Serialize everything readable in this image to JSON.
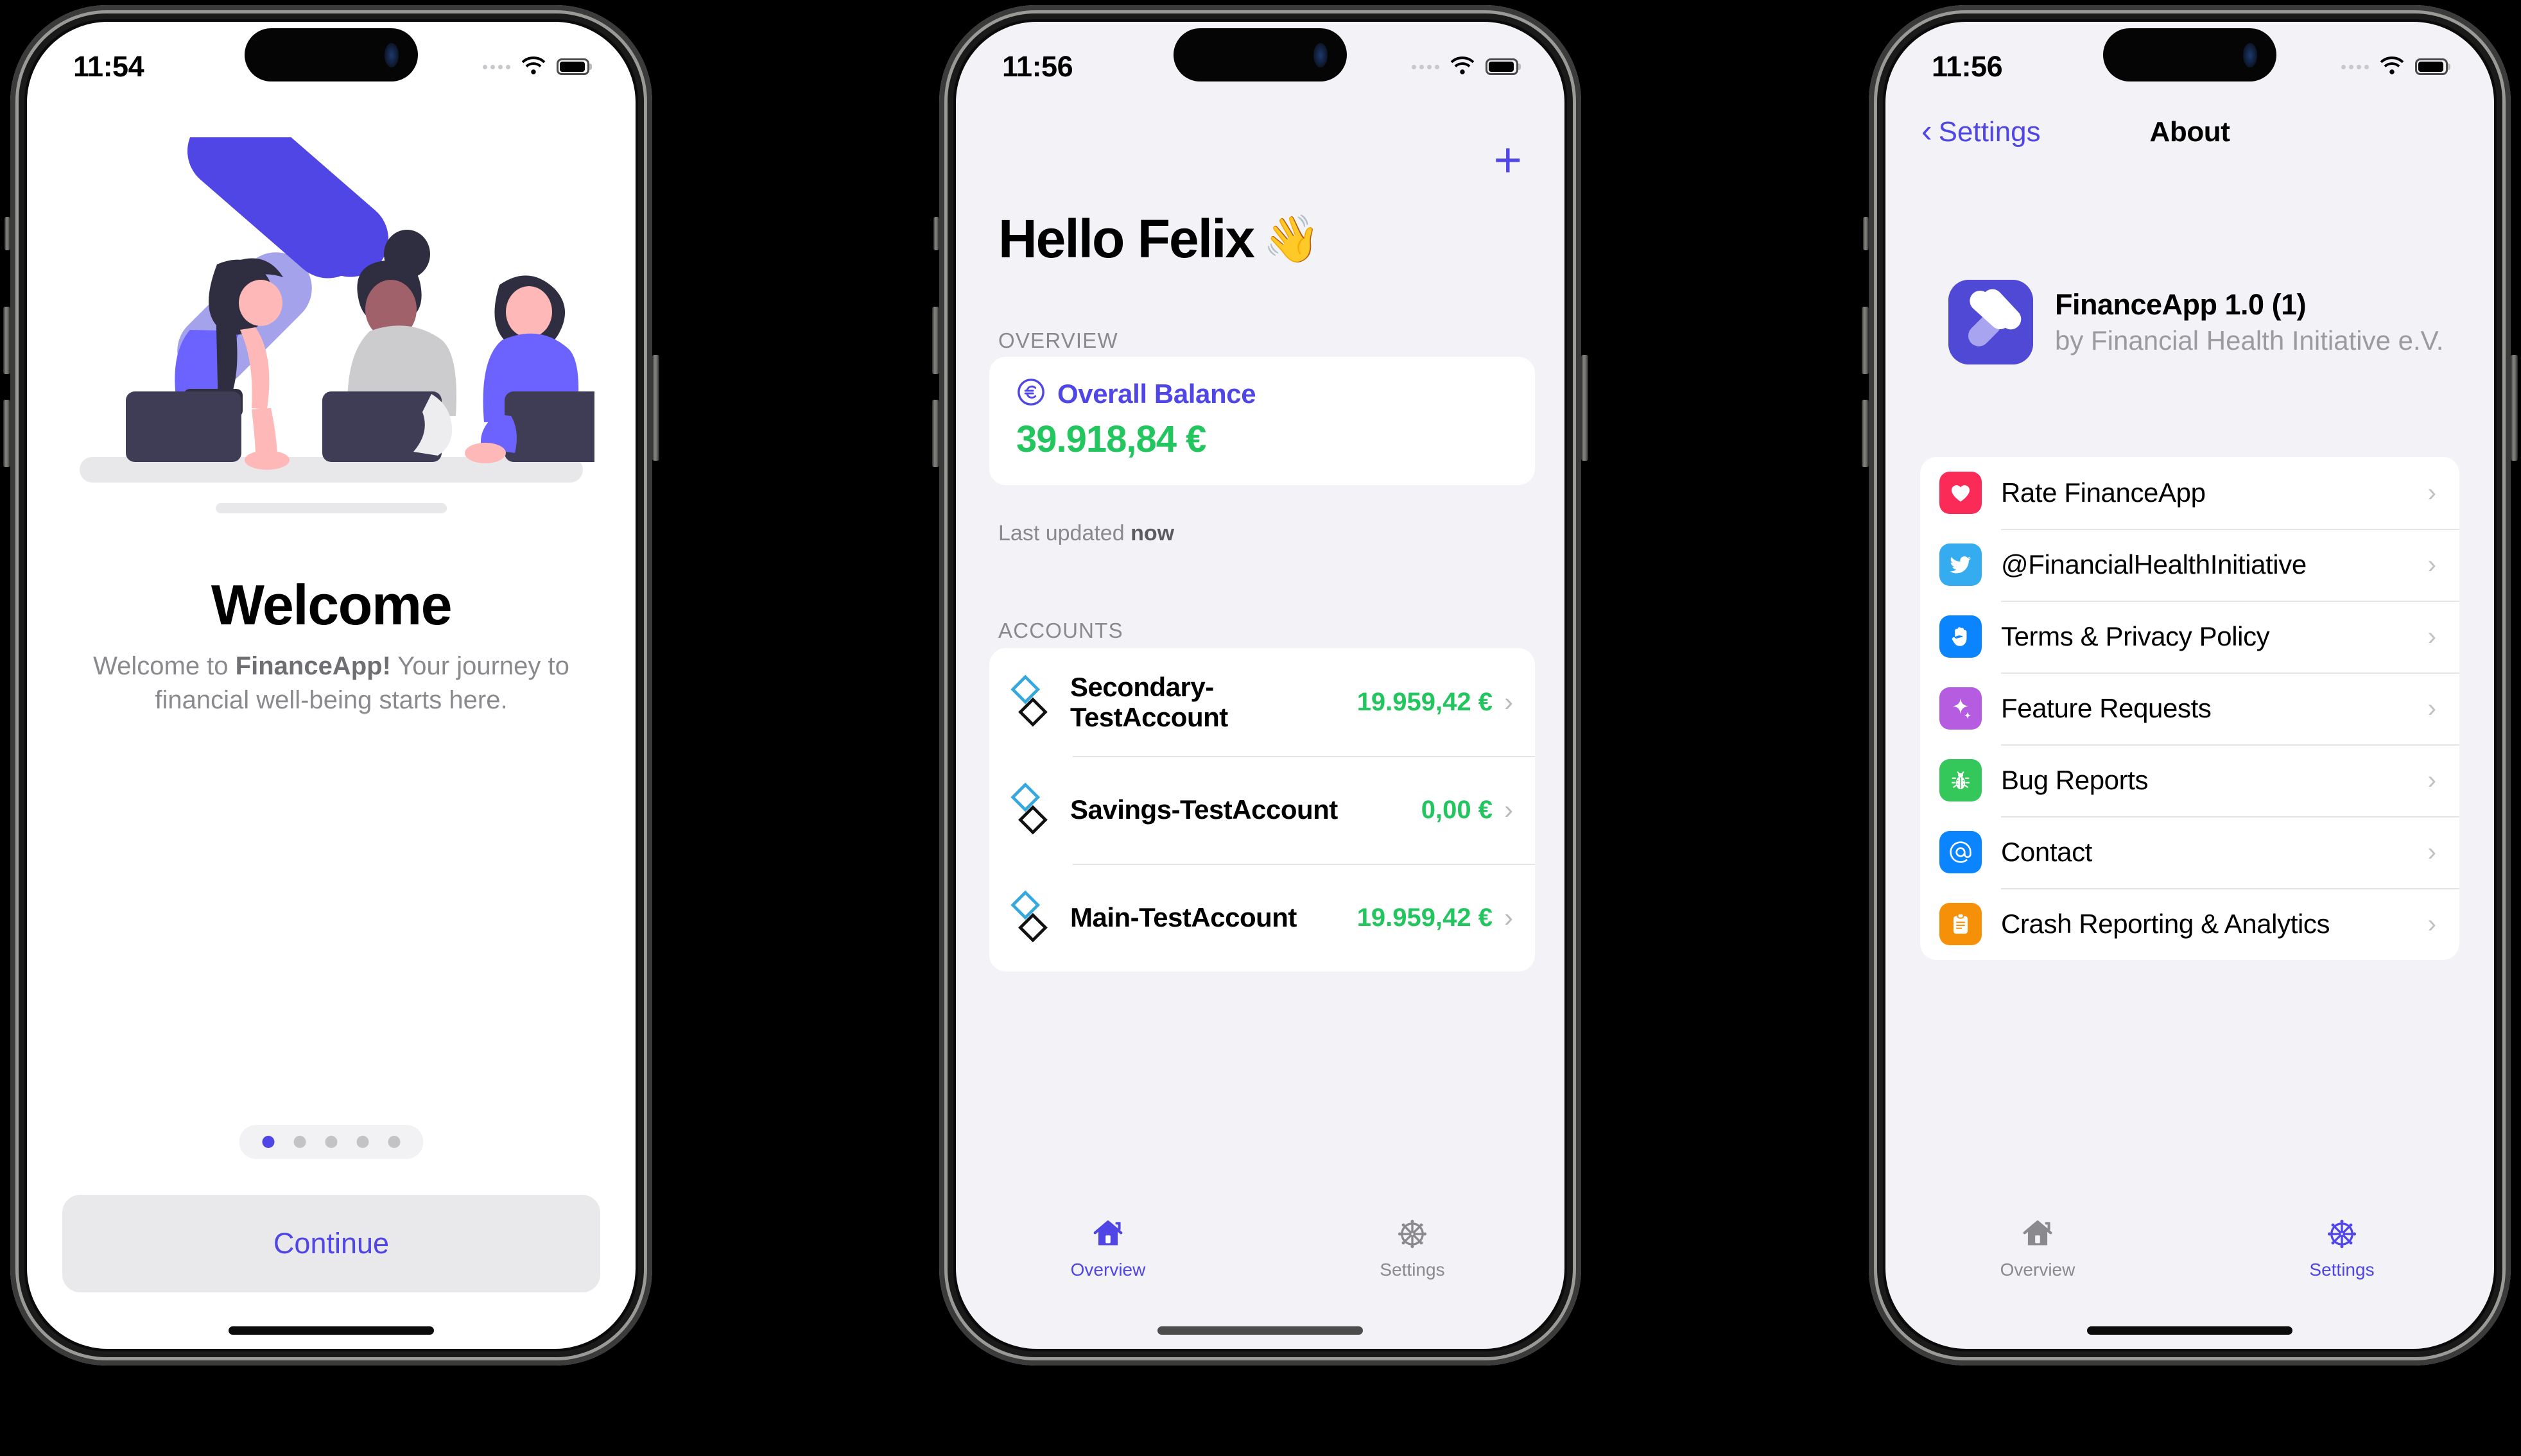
{
  "phones": [
    {
      "id": "welcome",
      "status": {
        "time": "11:54",
        "wifi_icon": "wifi-icon",
        "battery_icon": "battery-icon",
        "signal_icon": "cellular-dots-icon"
      },
      "welcome": {
        "title": "Welcome",
        "subtitle_pre": "Welcome to ",
        "subtitle_bold": "FinanceApp!",
        "subtitle_post": " Your journey to financial well-being starts here.",
        "page_indicator": {
          "total": 5,
          "active_index": 0
        },
        "continue_label": "Continue"
      }
    },
    {
      "id": "overview",
      "status": {
        "time": "11:56",
        "wifi_icon": "wifi-icon",
        "battery_icon": "battery-icon",
        "signal_icon": "cellular-dots-icon"
      },
      "overview": {
        "add_icon": "plus-icon",
        "greeting": "Hello Felix",
        "greeting_emoji": "👋",
        "section_overview": "OVERVIEW",
        "balance_icon": "euro-circle-icon",
        "balance_title": "Overall Balance",
        "balance_amount": "39.918,84 €",
        "last_updated_pre": "Last updated ",
        "last_updated_value": "now",
        "section_accounts": "ACCOUNTS",
        "accounts": [
          {
            "name": "Secondary-TestAccount",
            "amount": "19.959,42 €",
            "icon": "double-diamond-icon",
            "chevron": "chevron-right-icon"
          },
          {
            "name": "Savings-TestAccount",
            "amount": "0,00 €",
            "icon": "double-diamond-icon",
            "chevron": "chevron-right-icon"
          },
          {
            "name": "Main-TestAccount",
            "amount": "19.959,42 €",
            "icon": "double-diamond-icon",
            "chevron": "chevron-right-icon"
          }
        ]
      },
      "tabbar": {
        "tabs": [
          {
            "label": "Overview",
            "icon": "house-icon",
            "active": true
          },
          {
            "label": "Settings",
            "icon": "gear-icon",
            "active": false
          }
        ]
      }
    },
    {
      "id": "about",
      "status": {
        "time": "11:56",
        "wifi_icon": "wifi-icon",
        "battery_icon": "battery-icon",
        "signal_icon": "cellular-dots-icon"
      },
      "about": {
        "back_label": "Settings",
        "back_icon": "chevron-left-icon",
        "title": "About",
        "app_icon": "financeapp-logo-icon",
        "app_name": "FinanceApp 1.0 (1)",
        "app_publisher": "by Financial Health Initiative e.V.",
        "rows": [
          {
            "label": "Rate FinanceApp",
            "icon": "heart-icon",
            "color": "#fa2b56"
          },
          {
            "label": "@FinancialHealthInitiative",
            "icon": "twitter-icon",
            "color": "#35acef"
          },
          {
            "label": "Terms & Privacy Policy",
            "icon": "hand-raised-icon",
            "color": "#0b84ff"
          },
          {
            "label": "Feature Requests",
            "icon": "sparkle-icon",
            "color": "#b55ce0"
          },
          {
            "label": "Bug Reports",
            "icon": "ant-bug-icon",
            "color": "#34c759"
          },
          {
            "label": "Contact",
            "icon": "at-sign-icon",
            "color": "#0b84ff"
          },
          {
            "label": "Crash Reporting & Analytics",
            "icon": "clipboard-icon",
            "color": "#f79009"
          }
        ]
      },
      "tabbar": {
        "tabs": [
          {
            "label": "Overview",
            "icon": "house-icon",
            "active": false
          },
          {
            "label": "Settings",
            "icon": "gear-icon",
            "active": true
          }
        ]
      }
    }
  ],
  "colors": {
    "accent": "#4f46e5",
    "positive": "#22c55e",
    "screen_bg": "#f3f2f7",
    "card_bg": "#ffffff",
    "muted_text": "#8a8a8e"
  }
}
